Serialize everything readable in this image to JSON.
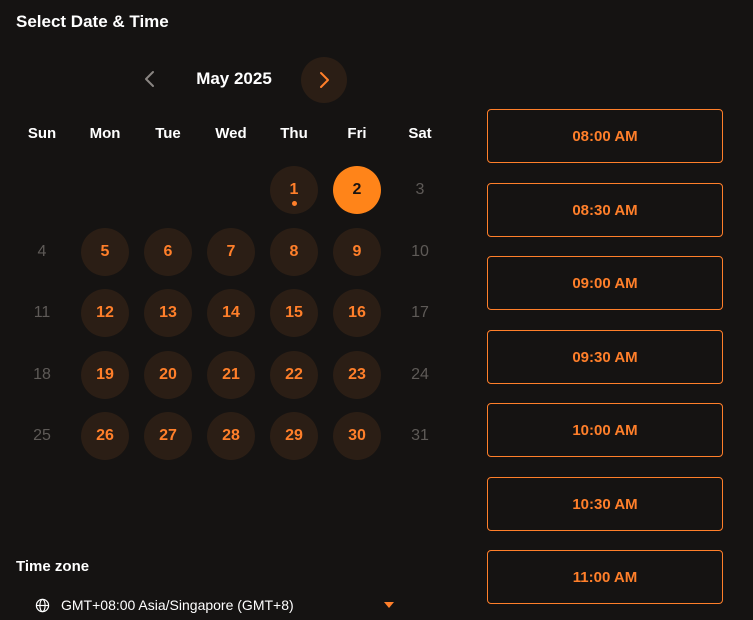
{
  "title": "Select Date & Time",
  "calendar": {
    "month_label": "May 2025",
    "prev_icon": "chevron-left-icon",
    "next_icon": "chevron-right-icon",
    "weekdays": [
      "Sun",
      "Mon",
      "Tue",
      "Wed",
      "Thu",
      "Fri",
      "Sat"
    ],
    "first_weekday_index": 4,
    "days": [
      {
        "label": "1",
        "state": "available",
        "today": true
      },
      {
        "label": "2",
        "state": "selected",
        "today": false
      },
      {
        "label": "3",
        "state": "disabled",
        "today": false
      },
      {
        "label": "4",
        "state": "disabled",
        "today": false
      },
      {
        "label": "5",
        "state": "available",
        "today": false
      },
      {
        "label": "6",
        "state": "available",
        "today": false
      },
      {
        "label": "7",
        "state": "available",
        "today": false
      },
      {
        "label": "8",
        "state": "available",
        "today": false
      },
      {
        "label": "9",
        "state": "available",
        "today": false
      },
      {
        "label": "10",
        "state": "disabled",
        "today": false
      },
      {
        "label": "11",
        "state": "disabled",
        "today": false
      },
      {
        "label": "12",
        "state": "available",
        "today": false
      },
      {
        "label": "13",
        "state": "available",
        "today": false
      },
      {
        "label": "14",
        "state": "available",
        "today": false
      },
      {
        "label": "15",
        "state": "available",
        "today": false
      },
      {
        "label": "16",
        "state": "available",
        "today": false
      },
      {
        "label": "17",
        "state": "disabled",
        "today": false
      },
      {
        "label": "18",
        "state": "disabled",
        "today": false
      },
      {
        "label": "19",
        "state": "available",
        "today": false
      },
      {
        "label": "20",
        "state": "available",
        "today": false
      },
      {
        "label": "21",
        "state": "available",
        "today": false
      },
      {
        "label": "22",
        "state": "available",
        "today": false
      },
      {
        "label": "23",
        "state": "available",
        "today": false
      },
      {
        "label": "24",
        "state": "disabled",
        "today": false
      },
      {
        "label": "25",
        "state": "disabled",
        "today": false
      },
      {
        "label": "26",
        "state": "available",
        "today": false
      },
      {
        "label": "27",
        "state": "available",
        "today": false
      },
      {
        "label": "28",
        "state": "available",
        "today": false
      },
      {
        "label": "29",
        "state": "available",
        "today": false
      },
      {
        "label": "30",
        "state": "available",
        "today": false
      },
      {
        "label": "31",
        "state": "disabled",
        "today": false
      }
    ]
  },
  "time_slots": [
    "08:00 AM",
    "08:30 AM",
    "09:00 AM",
    "09:30 AM",
    "10:00 AM",
    "10:30 AM",
    "11:00 AM"
  ],
  "timezone": {
    "label": "Time zone",
    "value": "GMT+08:00 Asia/Singapore (GMT+8)",
    "icon": "globe-icon",
    "caret_icon": "caret-down-icon"
  },
  "colors": {
    "background": "#151312",
    "accent": "#ff7f2a",
    "selected_fill": "#ff8419",
    "available_fill": "#2b1e15",
    "disabled_text": "#5e5a57"
  }
}
